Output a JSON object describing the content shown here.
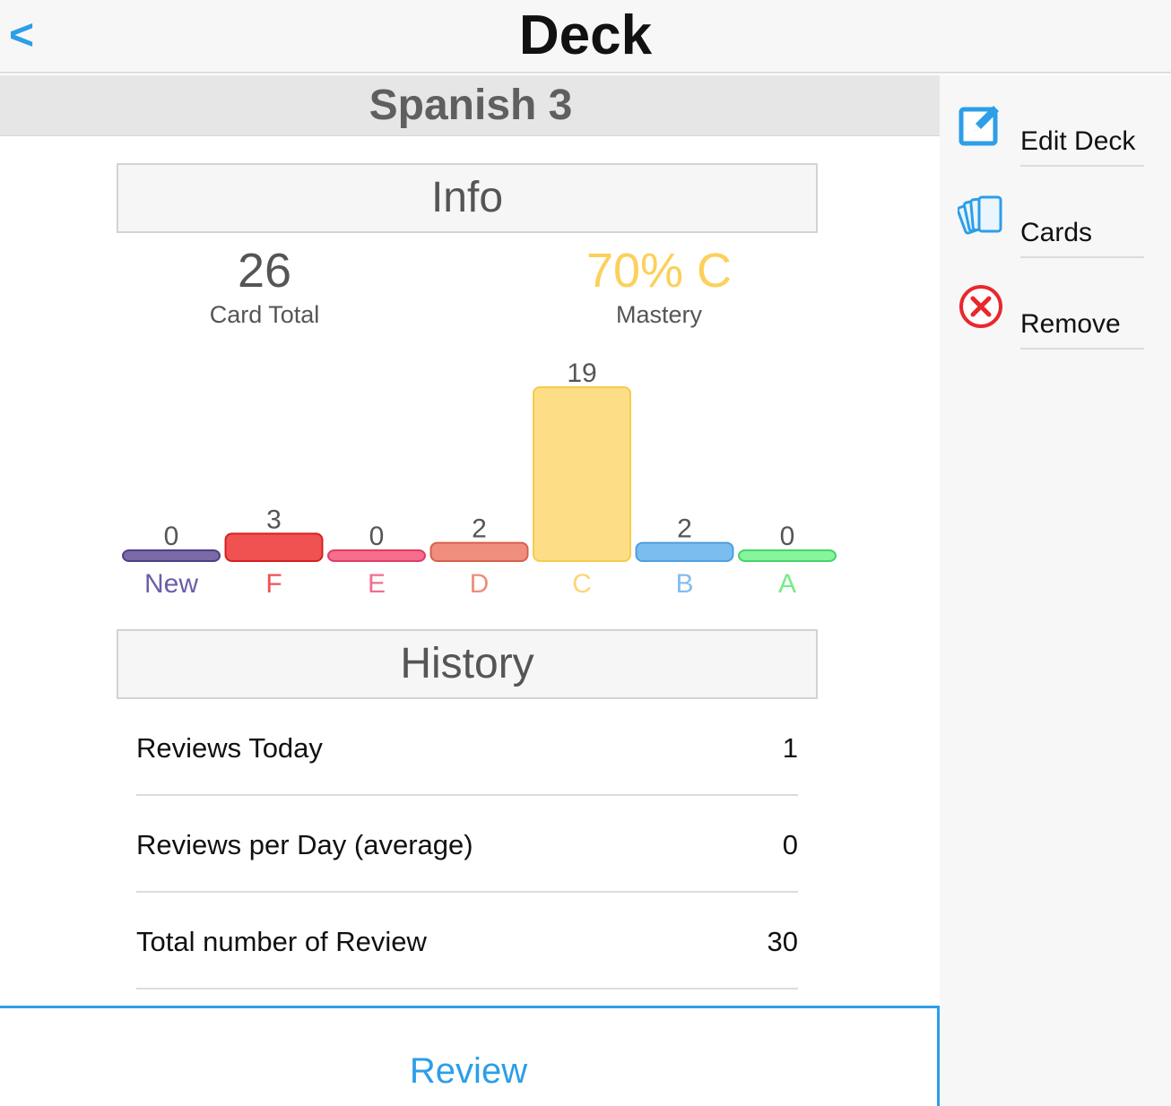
{
  "header": {
    "back_label": "<",
    "title": "Deck"
  },
  "deck": {
    "name": "Spanish 3"
  },
  "side_menu": {
    "items": [
      {
        "label": "Edit Deck",
        "icon": "edit-icon"
      },
      {
        "label": "Cards",
        "icon": "cards-icon"
      },
      {
        "label": "Remove",
        "icon": "remove-icon"
      }
    ]
  },
  "info": {
    "heading": "Info",
    "card_total_value": "26",
    "card_total_label": "Card Total",
    "mastery_value": "70% C",
    "mastery_label": "Mastery"
  },
  "colors": {
    "accent": "#2d9ee8",
    "mastery": "#fcd05a",
    "danger": "#e8282d"
  },
  "chart_data": {
    "type": "bar",
    "categories": [
      "New",
      "F",
      "E",
      "D",
      "C",
      "B",
      "A"
    ],
    "values": [
      0,
      3,
      0,
      2,
      19,
      2,
      0
    ],
    "colors": [
      "#7b6aa7",
      "#f05252",
      "#f56e8c",
      "#ef8e7c",
      "#fddd86",
      "#7bbdee",
      "#86f59b"
    ],
    "stroke_colors": [
      "#4e3f86",
      "#d52020",
      "#df3d63",
      "#d6614c",
      "#f7cb4d",
      "#4e9fe0",
      "#46d36b"
    ],
    "label_colors": [
      "#6b5ea8",
      "#f05252",
      "#f07090",
      "#ef8e7c",
      "#fcd678",
      "#86bdee",
      "#77eb88"
    ],
    "ylim": [
      0,
      19
    ]
  },
  "history": {
    "heading": "History",
    "rows": [
      {
        "label": "Reviews Today",
        "value": "1"
      },
      {
        "label": "Reviews per Day (average)",
        "value": "0"
      },
      {
        "label": "Total number of Review",
        "value": "30"
      }
    ]
  },
  "review_button": {
    "label": "Review"
  }
}
